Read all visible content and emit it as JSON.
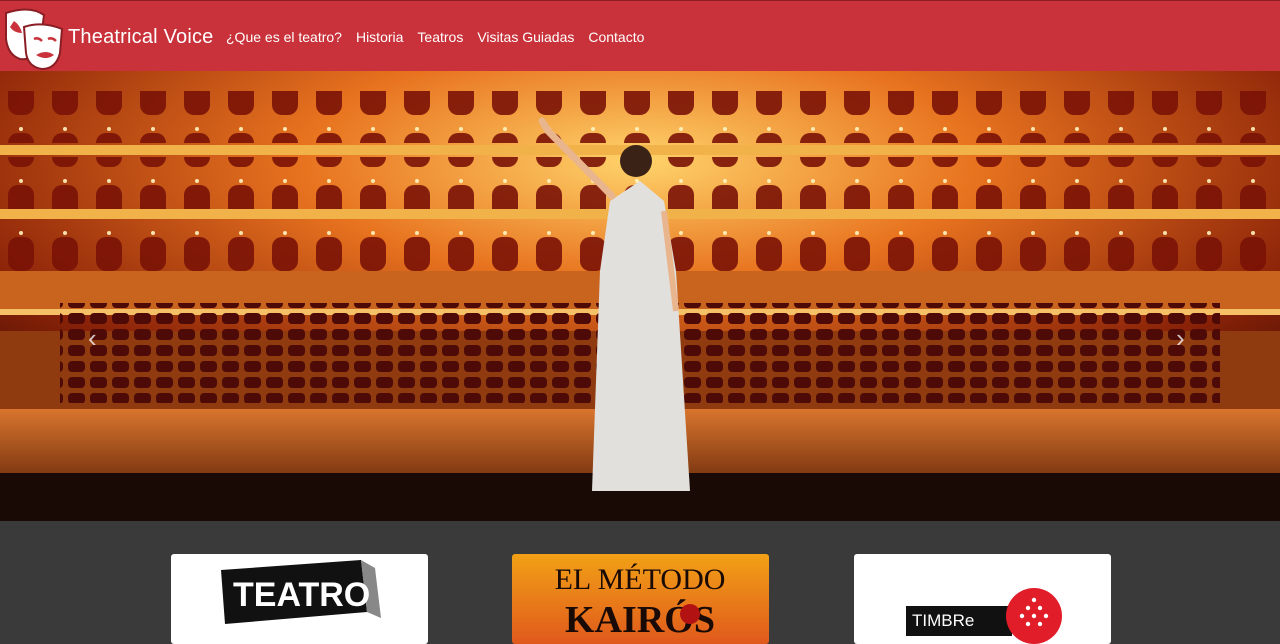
{
  "brand": {
    "name": "Theatrical Voice",
    "logo_icon": "theater-masks-icon"
  },
  "nav": {
    "items": [
      {
        "label": "¿Que es el teatro?"
      },
      {
        "label": "Historia"
      },
      {
        "label": "Teatros"
      },
      {
        "label": "Visitas Guiadas"
      },
      {
        "label": "Contacto"
      }
    ]
  },
  "carousel": {
    "prev_icon": "chevron-left-icon",
    "next_icon": "chevron-right-icon",
    "prev_glyph": "‹",
    "next_glyph": "›"
  },
  "cards": [
    {
      "logo_text": "TEATRO"
    },
    {
      "logo_text": "EL MÉTODO",
      "logo_subtext": "KAIRÓS"
    },
    {
      "logo_text": "TIMBRe"
    }
  ],
  "colors": {
    "navbar": "#c9323a",
    "footer": "#3a3a3a",
    "accent_red": "#e11d2a"
  }
}
